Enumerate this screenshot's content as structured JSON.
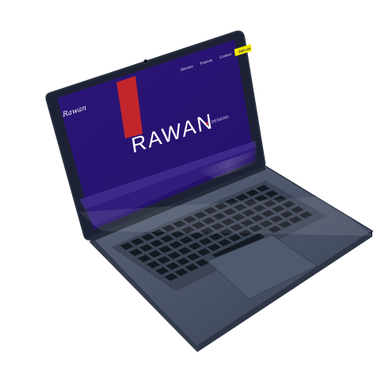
{
  "colors": {
    "screen_background": "#2b1576",
    "accent_red": "#c2262c",
    "cta_yellow": "#f3e600",
    "laptop_body": "#4b5468",
    "bezel": "#1c2233",
    "key": "#141820"
  },
  "site": {
    "logo_text": "Rawan",
    "nav": {
      "items": [
        {
          "label": "Aboutus"
        },
        {
          "label": "Projects"
        },
        {
          "label": "Contact"
        }
      ],
      "cta_label": "Join us"
    },
    "hero": {
      "wordmark": "RAWAN",
      "subtitle": "DESIGNS"
    }
  },
  "device": {
    "type": "laptop",
    "icons": [
      "webcam-icon",
      "keyboard-icon",
      "trackpad-icon"
    ]
  }
}
